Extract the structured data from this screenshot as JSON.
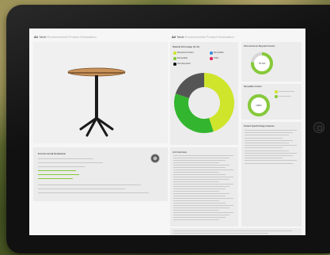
{
  "left_section": {
    "number": "A1",
    "title": "Table",
    "subtitle": "Environmental Product Declaration",
    "info_title": "Environmental Declaration",
    "info_lines": 9,
    "info_green_lines": 3,
    "seal_icon": "recycle-seal-icon"
  },
  "right_section": {
    "number": "A2",
    "title": "Table",
    "subtitle": "Environmental Product Declaration",
    "materials_title": "Material Percentage (by W)",
    "legend": [
      {
        "label": "Recycled Content",
        "color": "#cfe52c"
      },
      {
        "label": "Recyclable",
        "color": "#3c8ed9"
      },
      {
        "label": "Renewable",
        "color": "#86c93a"
      },
      {
        "label": "Other",
        "color": "#e0245e"
      },
      {
        "label": "Non-Recycled",
        "color": "#111111"
      }
    ],
    "recycled_title": "Post-Consumer Recycled Content",
    "recycled_value": "76.4%",
    "recyclable_title": "Recyclable Content",
    "recyclable_value": "100%",
    "lca_title": "LCA Summary",
    "report_title": "Product Specific Design Features"
  },
  "chart_data": {
    "type": "pie",
    "categories": [
      "Recycled",
      "Renewable",
      "Other"
    ],
    "values": [
      45,
      35,
      20
    ],
    "colors": [
      "#cfe52c",
      "#33b52f",
      "#555555"
    ]
  },
  "progress": {
    "recycled": 0.764,
    "recyclable": 1.0
  },
  "colors": {
    "accent_green": "#86c93a",
    "lime": "#cfe52c",
    "dark": "#111111"
  },
  "footer": {
    "logos": [
      "logo-1",
      "logo-2",
      "logo-3",
      "logo-4",
      "logo-5",
      "logo-6"
    ]
  }
}
